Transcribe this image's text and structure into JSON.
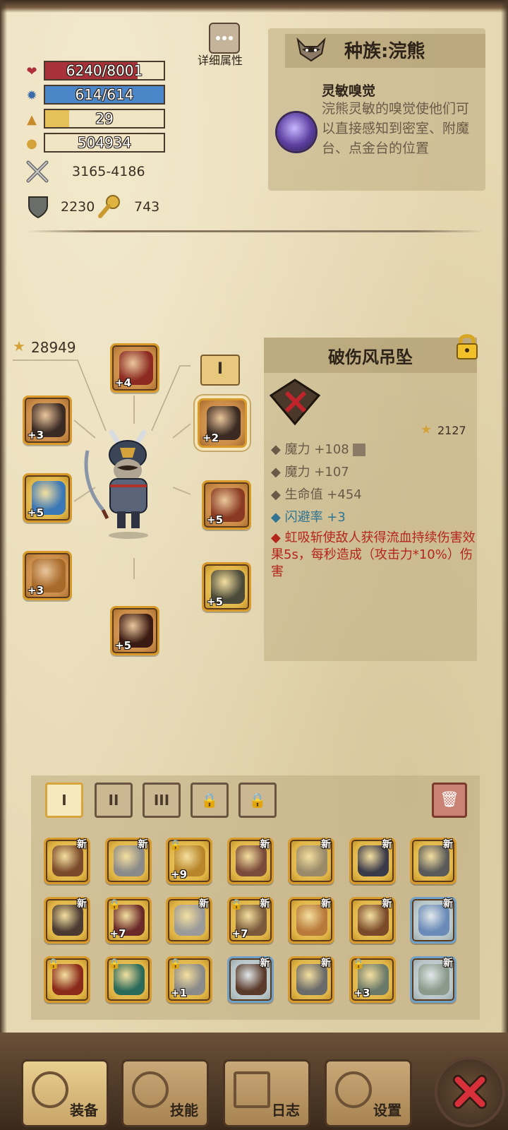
{
  "stats": {
    "hp": {
      "text": "6240/8001",
      "fraction": 0.78,
      "color": "#a8323a"
    },
    "mp": {
      "text": "614/614",
      "fraction": 1.0,
      "color": "#4a86c8"
    },
    "level": {
      "text": "29",
      "fraction": 0.2,
      "color": "#e4c257"
    },
    "gold": {
      "text": "504934"
    },
    "attack": "3165-4186",
    "defense": "2230",
    "magic": "743"
  },
  "details_button": {
    "label": "详细属性",
    "icon": "ellipsis-icon"
  },
  "race": {
    "title": "种族:浣熊",
    "skill_name": "灵敏嗅觉",
    "skill_desc": "浣熊灵敏的嗅觉使他们可以直接感知到密室、附魔台、点金台的位置"
  },
  "gear_score": "28949",
  "equipped": {
    "helmet": {
      "level": "+4",
      "color": "#8c2a22"
    },
    "mask": {
      "level": "+3",
      "color": "#3a2a24"
    },
    "weapon": {
      "level": "+5",
      "color": "#3a78b8"
    },
    "gloves": {
      "level": "+3",
      "color": "#a86a2a"
    },
    "boots": {
      "level": "+5",
      "color": "#3a1a12"
    },
    "amulet": {
      "level": "+2",
      "color": "#3a2a22"
    },
    "cloak": {
      "level": "+5",
      "color": "#8a3a22"
    },
    "pants": {
      "level": "+5",
      "color": "#4a4a3a"
    }
  },
  "tier_tag": "I",
  "item_detail": {
    "name": "破伤风吊坠",
    "stars": "2127",
    "stats": [
      {
        "text": "魔力 +108",
        "style": "normal"
      },
      {
        "text": "魔力 +107",
        "style": "normal"
      },
      {
        "text": "生命值 +454",
        "style": "normal"
      },
      {
        "text": "闪避率 +3",
        "style": "blue"
      }
    ],
    "effect": "虹吸斩使敌人获得流血持续伤害效果5s，每秒造成（攻击力*10%）伤害"
  },
  "inventory_tabs": [
    "I",
    "II",
    "III"
  ],
  "new_label": "新",
  "inventory": [
    {
      "level": "",
      "is_new": true,
      "locked": false,
      "color": "#7a4a2a",
      "frame": "gold"
    },
    {
      "level": "",
      "is_new": true,
      "locked": false,
      "color": "#8a8a8a",
      "frame": "gold"
    },
    {
      "level": "+9",
      "is_new": false,
      "locked": true,
      "color": "#b8862a",
      "frame": "gold"
    },
    {
      "level": "",
      "is_new": true,
      "locked": false,
      "color": "#7a4a3a",
      "frame": "gold"
    },
    {
      "level": "",
      "is_new": true,
      "locked": false,
      "color": "#9a8a6a",
      "frame": "gold"
    },
    {
      "level": "",
      "is_new": true,
      "locked": false,
      "color": "#3a3a4a",
      "frame": "gold"
    },
    {
      "level": "",
      "is_new": true,
      "locked": false,
      "color": "#5a5a5a",
      "frame": "gold"
    },
    {
      "level": "",
      "is_new": true,
      "locked": false,
      "color": "#4a3a32",
      "frame": "gold"
    },
    {
      "level": "+7",
      "is_new": false,
      "locked": true,
      "color": "#6a2a2a",
      "frame": "gold"
    },
    {
      "level": "",
      "is_new": true,
      "locked": false,
      "color": "#9a9a9a",
      "frame": "gold"
    },
    {
      "level": "+7",
      "is_new": true,
      "locked": true,
      "color": "#7a5a3a",
      "frame": "gold"
    },
    {
      "level": "",
      "is_new": true,
      "locked": false,
      "color": "#b87a3a",
      "frame": "gold"
    },
    {
      "level": "",
      "is_new": true,
      "locked": false,
      "color": "#7a4a2a",
      "frame": "gold"
    },
    {
      "level": "",
      "is_new": true,
      "locked": false,
      "color": "#6a8ab8",
      "frame": "blue"
    },
    {
      "level": "",
      "is_new": false,
      "locked": true,
      "color": "#8a2a1a",
      "frame": "gold"
    },
    {
      "level": "",
      "is_new": false,
      "locked": true,
      "color": "#2a6a5a",
      "frame": "gold"
    },
    {
      "level": "+1",
      "is_new": false,
      "locked": true,
      "color": "#8a8a8a",
      "frame": "gold"
    },
    {
      "level": "",
      "is_new": true,
      "locked": false,
      "color": "#5a3a2a",
      "frame": "blue"
    },
    {
      "level": "",
      "is_new": true,
      "locked": false,
      "color": "#6a6a6a",
      "frame": "gold"
    },
    {
      "level": "+3",
      "is_new": false,
      "locked": true,
      "color": "#6a7a6a",
      "frame": "gold"
    },
    {
      "level": "",
      "is_new": true,
      "locked": false,
      "color": "#8a9a8a",
      "frame": "blue"
    }
  ],
  "nav": {
    "equipment": "装备",
    "skills": "技能",
    "journal": "日志",
    "settings": "设置"
  }
}
